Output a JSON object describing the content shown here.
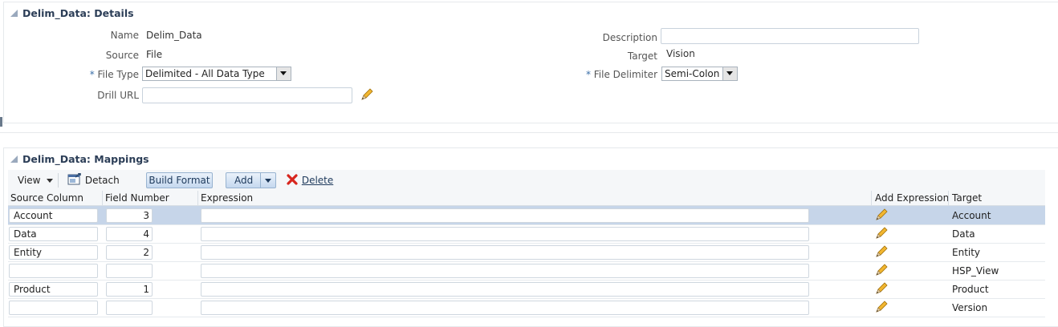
{
  "details": {
    "header": "Delim_Data: Details",
    "name_label": "Name",
    "name_value": "Delim_Data",
    "source_label": "Source",
    "source_value": "File",
    "file_type_label": "File Type",
    "file_type_value": "Delimited - All Data Type",
    "drill_url_label": "Drill URL",
    "drill_url_value": "",
    "description_label": "Description",
    "description_value": "",
    "target_label": "Target",
    "target_value": "Vision",
    "file_delimiter_label": "File Delimiter",
    "file_delimiter_value": "Semi-Colon",
    "required_marker": "*"
  },
  "mappings": {
    "header": "Delim_Data: Mappings",
    "toolbar": {
      "view_label": "View",
      "detach_label": "Detach",
      "build_format_label": "Build Format",
      "add_label": "Add",
      "delete_label": "Delete"
    },
    "columns": [
      "Source Column",
      "Field Number",
      "Expression",
      "Add Expression",
      "Target"
    ],
    "rows": [
      {
        "source": "Account",
        "field": "3",
        "expression": "",
        "target": "Account"
      },
      {
        "source": "Data",
        "field": "4",
        "expression": "",
        "target": "Data"
      },
      {
        "source": "Entity",
        "field": "2",
        "expression": "",
        "target": "Entity"
      },
      {
        "source": "",
        "field": "",
        "expression": "",
        "target": "HSP_View"
      },
      {
        "source": "Product",
        "field": "1",
        "expression": "",
        "target": "Product"
      },
      {
        "source": "",
        "field": "",
        "expression": "",
        "target": "Version"
      }
    ]
  },
  "colors": {
    "header_text": "#2c3e57",
    "selected_row": "#c6d5e9",
    "required_marker": "#3b6fa8",
    "delete_icon": "#d7261e",
    "pencil_icon": "#e0a21a"
  }
}
